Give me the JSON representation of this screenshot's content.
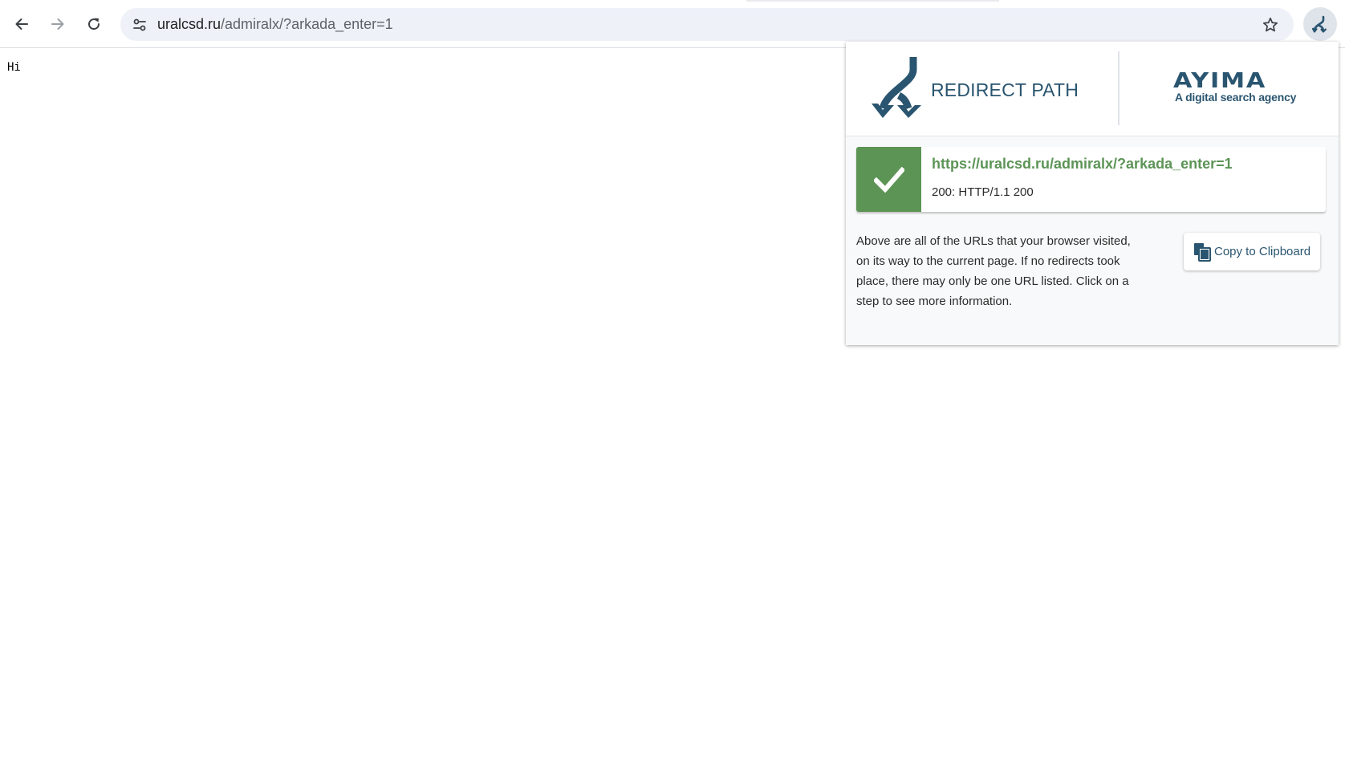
{
  "browser": {
    "url_host": "uralcsd.ru",
    "url_path": "/admiralx/?arkada_enter=1"
  },
  "page": {
    "body_text": "Hi"
  },
  "extension": {
    "brand_name": "REDIRECT PATH",
    "partner_logo_text": "AYIMA",
    "partner_tagline": "A digital search agency",
    "steps": [
      {
        "url": "https://uralcsd.ru/admiralx/?arkada_enter=1",
        "status": "200: HTTP/1.1 200",
        "status_color": "#5c9456"
      }
    ],
    "info_text": "Above are all of the URLs that your browser visited, on its way to the current page. If no redirects took place, there may only be one URL listed. Click on a step to see more information.",
    "copy_button_label": "Copy to Clipboard"
  },
  "colors": {
    "brand": "#2a5570",
    "success": "#5c9456",
    "omnibox_bg": "#eef1f8"
  }
}
